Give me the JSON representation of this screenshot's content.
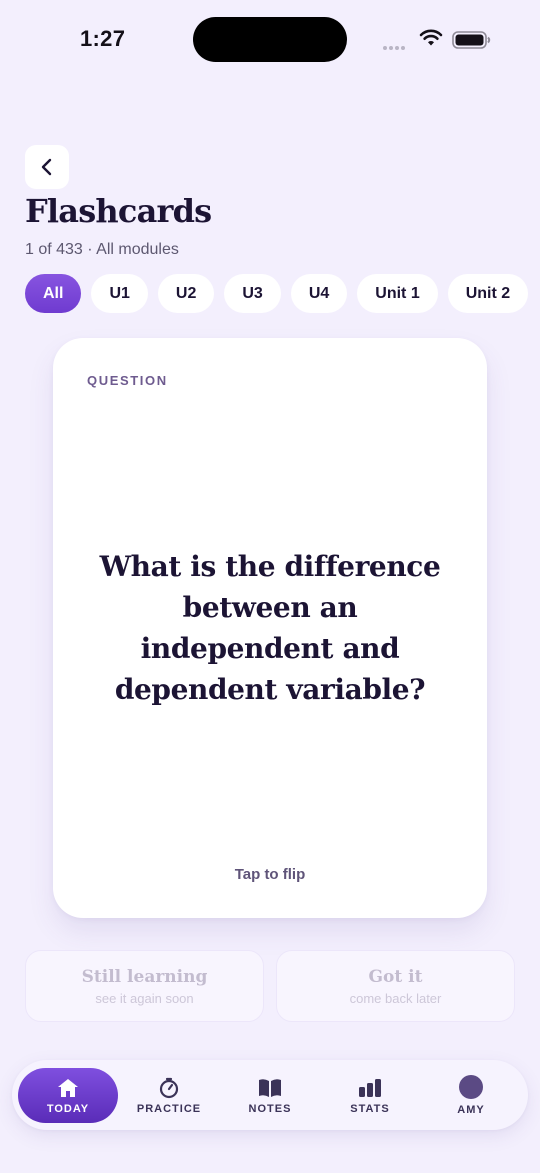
{
  "status_bar": {
    "time": "1:27",
    "icons": [
      "signal-dots-icon",
      "wifi-icon",
      "battery-icon"
    ]
  },
  "header": {
    "back_icon": "chevron-left-icon",
    "title": "Flashcards",
    "subtitle": "1 of 433 · All modules"
  },
  "filters": {
    "chips": [
      {
        "label": "All",
        "active": true
      },
      {
        "label": "U1",
        "active": false
      },
      {
        "label": "U2",
        "active": false
      },
      {
        "label": "U3",
        "active": false
      },
      {
        "label": "U4",
        "active": false
      },
      {
        "label": "Unit 1",
        "active": false
      },
      {
        "label": "Unit 2",
        "active": false
      }
    ]
  },
  "card": {
    "label": "QUESTION",
    "question": "What is the difference between an independent and dependent variable?",
    "hint": "Tap to flip"
  },
  "actions": {
    "still_learning": {
      "title": "Still learning",
      "subtitle": "see it again soon"
    },
    "got_it": {
      "title": "Got it",
      "subtitle": "come back later"
    }
  },
  "tab_bar": {
    "items": [
      {
        "label": "TODAY",
        "icon": "home-icon",
        "active": true
      },
      {
        "label": "PRACTICE",
        "icon": "timer-icon",
        "active": false
      },
      {
        "label": "NOTES",
        "icon": "book-icon",
        "active": false
      },
      {
        "label": "STATS",
        "icon": "bar-chart-icon",
        "active": false
      },
      {
        "label": "AMY",
        "icon": "avatar",
        "active": false
      }
    ]
  },
  "colors": {
    "background": "#f3effd",
    "accent": "#7e4de0",
    "text": "#1c1434",
    "card": "#ffffff"
  }
}
